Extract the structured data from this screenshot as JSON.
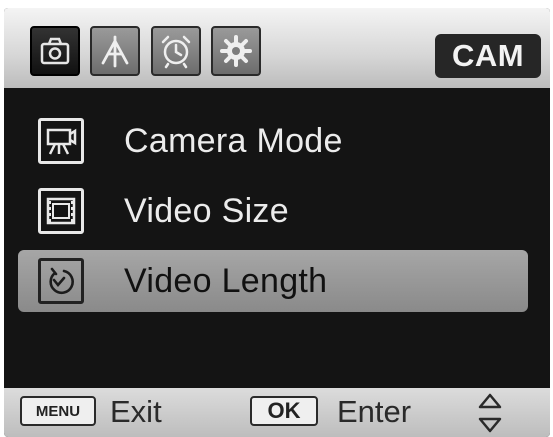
{
  "topbar": {
    "tabs": [
      {
        "icon": "camera-icon",
        "active": true
      },
      {
        "icon": "antenna-icon",
        "active": false
      },
      {
        "icon": "alarm-clock-icon",
        "active": false
      },
      {
        "icon": "gear-icon",
        "active": false
      }
    ],
    "mode_badge": "CAM"
  },
  "menu": {
    "items": [
      {
        "label": "Camera  Mode",
        "icon": "camcorder-icon",
        "selected": false
      },
      {
        "label": "Video Size",
        "icon": "film-frame-icon",
        "selected": false
      },
      {
        "label": "Video Length",
        "icon": "timer-icon",
        "selected": true
      }
    ]
  },
  "bottombar": {
    "menu_key": "MENU",
    "menu_action": "Exit",
    "ok_key": "OK",
    "ok_action": "Enter",
    "nav_icon": "up-down-arrows-icon"
  }
}
